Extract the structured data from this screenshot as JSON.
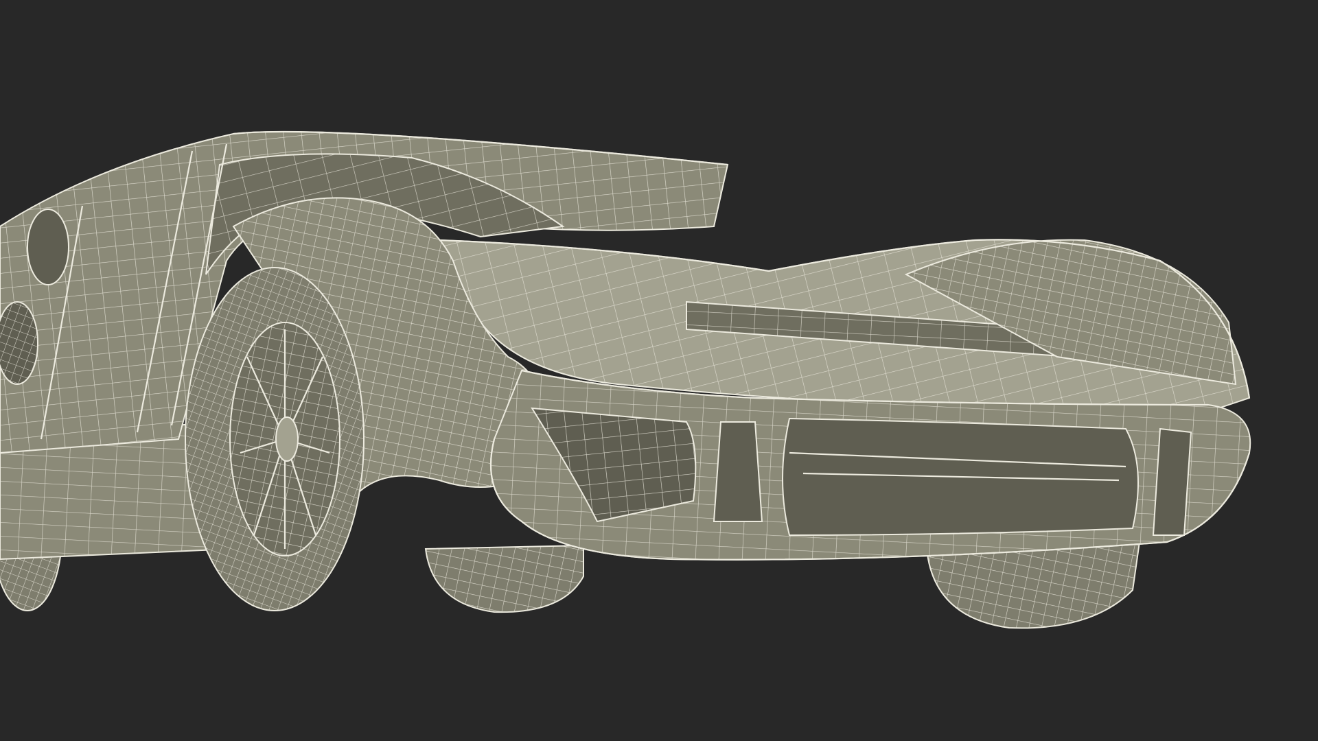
{
  "scene": {
    "subject": "wireframe-sports-car-3d-render",
    "colors": {
      "background": "#282828",
      "body_fill": "#8b8a78",
      "body_shade": "#6f6e5f",
      "body_light": "#a3a290",
      "wire": "#eceade",
      "cavity": "#5f5e51",
      "tire": "#7e7d6d"
    }
  }
}
